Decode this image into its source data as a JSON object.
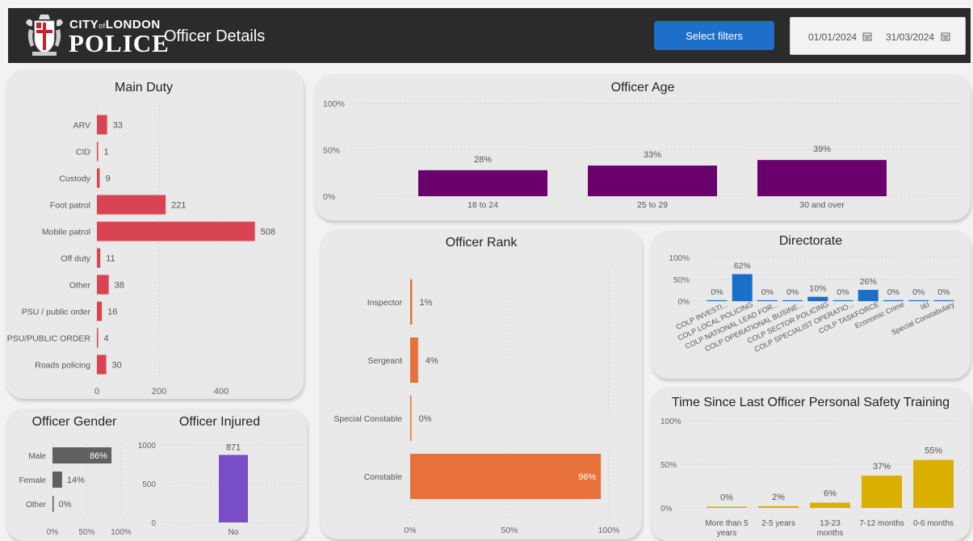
{
  "header": {
    "logo_top": "CITY",
    "logo_of": "of",
    "logo_london": "LONDON",
    "logo_police": "POLICE",
    "page_title": "Officer Details",
    "filter_button": "Select filters",
    "date_from": "01/01/2024",
    "date_to": "31/03/2024"
  },
  "colors": {
    "header_bg": "#2b2b2b",
    "filter_button": "#1e6fc9",
    "main_duty": "#d94452",
    "officer_age": "#6a006e",
    "officer_rank": "#e8703a",
    "directorate": "#1a6fc9",
    "gender": "#606060",
    "injured": "#7a4dc8",
    "training": "#d9b000"
  },
  "chart_data": [
    {
      "id": "main_duty",
      "type": "bar",
      "orientation": "horizontal",
      "title": "Main Duty",
      "categories": [
        "ARV",
        "CID",
        "Custody",
        "Foot patrol",
        "Mobile patrol",
        "Off duty",
        "Other",
        "PSU / public order",
        "PSU/PUBLIC ORDER",
        "Roads policing"
      ],
      "values": [
        33,
        1,
        9,
        221,
        508,
        11,
        38,
        16,
        4,
        30
      ],
      "value_labels": [
        "33",
        "1",
        "9",
        "221",
        "508",
        "11",
        "38",
        "16",
        "4",
        "30"
      ],
      "xticks": [
        "0",
        "200",
        "400"
      ],
      "xtick_values": [
        0,
        200,
        400
      ],
      "xlim": [
        0,
        540
      ]
    },
    {
      "id": "officer_age",
      "type": "bar",
      "title": "Officer Age",
      "categories": [
        "18 to 24",
        "25 to 29",
        "30 and over"
      ],
      "values": [
        28,
        33,
        39
      ],
      "value_labels": [
        "28%",
        "33%",
        "39%"
      ],
      "yticks": [
        "100%",
        "50%",
        "0%"
      ],
      "ylim": [
        0,
        100
      ]
    },
    {
      "id": "officer_rank",
      "type": "bar",
      "orientation": "horizontal",
      "title": "Officer Rank",
      "categories": [
        "Inspector",
        "Sergeant",
        "Special Constable",
        "Constable"
      ],
      "values": [
        1,
        4,
        0,
        96
      ],
      "value_labels": [
        "1%",
        "4%",
        "0%",
        "96%"
      ],
      "xticks": [
        "0%",
        "50%",
        "100%"
      ],
      "xlim": [
        0,
        100
      ]
    },
    {
      "id": "directorate",
      "type": "bar",
      "title": "Directorate",
      "categories": [
        "COLP INVESTI...",
        "COLP LOCAL POLICING",
        "COLP NATIONAL LEAD FOR...",
        "COLP OPERATIONAL BUSINE...",
        "COLP SECTOR POLICING",
        "COLP SPECIALIST OPERATIO...",
        "COLP TASKFORCE",
        "Economic Crime",
        "I&I",
        "Special Constabulary"
      ],
      "values": [
        0,
        62,
        0,
        0,
        10,
        0,
        26,
        0,
        0,
        0
      ],
      "value_labels": [
        "0%",
        "62%",
        "0%",
        "0%",
        "10%",
        "0%",
        "26%",
        "0%",
        "0%",
        "0%"
      ],
      "yticks": [
        "100%",
        "50%",
        "0%"
      ],
      "ylim": [
        0,
        100
      ]
    },
    {
      "id": "officer_gender",
      "type": "bar",
      "orientation": "horizontal",
      "title": "Officer Gender",
      "categories": [
        "Male",
        "Female",
        "Other"
      ],
      "values": [
        86,
        14,
        0
      ],
      "value_labels": [
        "86%",
        "14%",
        "0%"
      ],
      "xticks": [
        "0%",
        "50%",
        "100%"
      ],
      "xlim": [
        0,
        100
      ]
    },
    {
      "id": "officer_injured",
      "type": "bar",
      "title": "Officer Injured",
      "categories": [
        "No"
      ],
      "values": [
        871
      ],
      "value_labels": [
        "871"
      ],
      "yticks": [
        "1000",
        "500",
        "0"
      ],
      "ylim": [
        0,
        1000
      ]
    },
    {
      "id": "training",
      "type": "bar",
      "title": "Time Since Last Officer Personal Safety Training",
      "categories": [
        [
          "More than 5",
          "years"
        ],
        [
          "2-5 years"
        ],
        [
          "13-23",
          "months"
        ],
        [
          "7-12 months"
        ],
        [
          "0-6 months"
        ]
      ],
      "values": [
        0,
        2,
        6,
        37,
        55
      ],
      "value_labels": [
        "0%",
        "2%",
        "6%",
        "37%",
        "55%"
      ],
      "yticks": [
        "100%",
        "50%",
        "0%"
      ],
      "ylim": [
        0,
        100
      ]
    }
  ]
}
